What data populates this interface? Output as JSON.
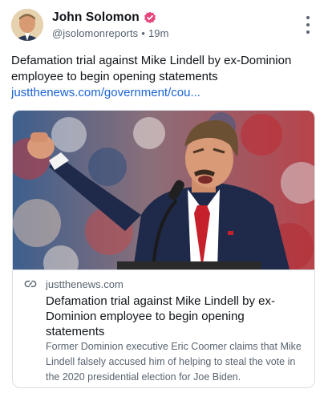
{
  "author": {
    "display_name": "John Solomon",
    "handle": "@jsolomonreports",
    "separator": "•",
    "time_ago": "19m",
    "verified_icon": "verified-badge-icon"
  },
  "post": {
    "text": "Defamation trial against Mike Lindell by ex-Dominion employee to begin opening statements",
    "link_text": "justthenews.com/government/cou..."
  },
  "link_card": {
    "domain": "justthenews.com",
    "title": "Defamation trial against Mike Lindell by ex-Dominion employee to begin opening statements",
    "description": "Former Dominion executive Eric Coomer claims that Mike Lindell falsely accused him of helping to steal the vote in the 2020 presidential election for Joe Biden."
  },
  "colors": {
    "accent_link": "#1a62d6",
    "verified_badge": "#e8457a",
    "text_primary": "#101418",
    "text_secondary": "#5a6470"
  }
}
